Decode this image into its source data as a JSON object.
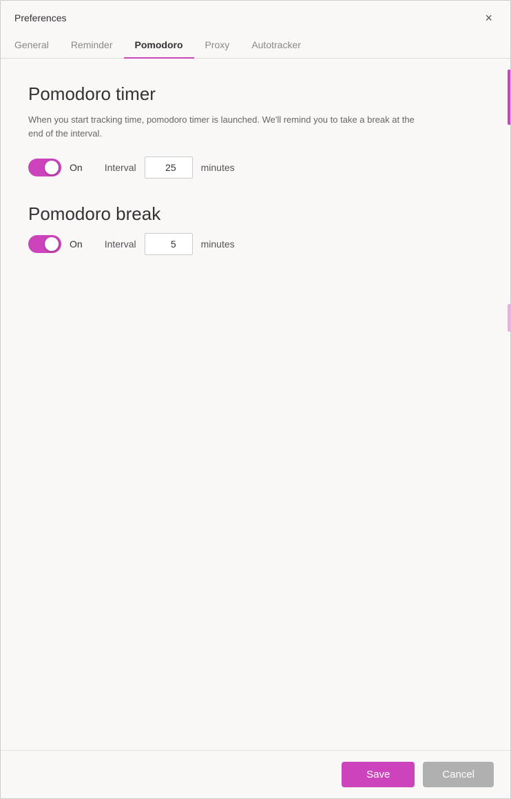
{
  "titlebar": {
    "title": "Preferences",
    "close_label": "×"
  },
  "tabs": [
    {
      "id": "general",
      "label": "General",
      "active": false
    },
    {
      "id": "reminder",
      "label": "Reminder",
      "active": false
    },
    {
      "id": "pomodoro",
      "label": "Pomodoro",
      "active": true
    },
    {
      "id": "proxy",
      "label": "Proxy",
      "active": false
    },
    {
      "id": "autotracker",
      "label": "Autotracker",
      "active": false
    }
  ],
  "pomodoro_timer": {
    "section_title": "Pomodoro timer",
    "description": "When you start tracking time, pomodoro timer is launched. We'll remind you to take a break at the end of the interval.",
    "toggle_label": "On",
    "interval_label": "Interval",
    "interval_value": "25",
    "minutes_label": "minutes"
  },
  "pomodoro_break": {
    "section_title": "Pomodoro break",
    "toggle_label": "On",
    "interval_label": "Interval",
    "interval_value": "5",
    "minutes_label": "minutes"
  },
  "footer": {
    "save_label": "Save",
    "cancel_label": "Cancel"
  }
}
